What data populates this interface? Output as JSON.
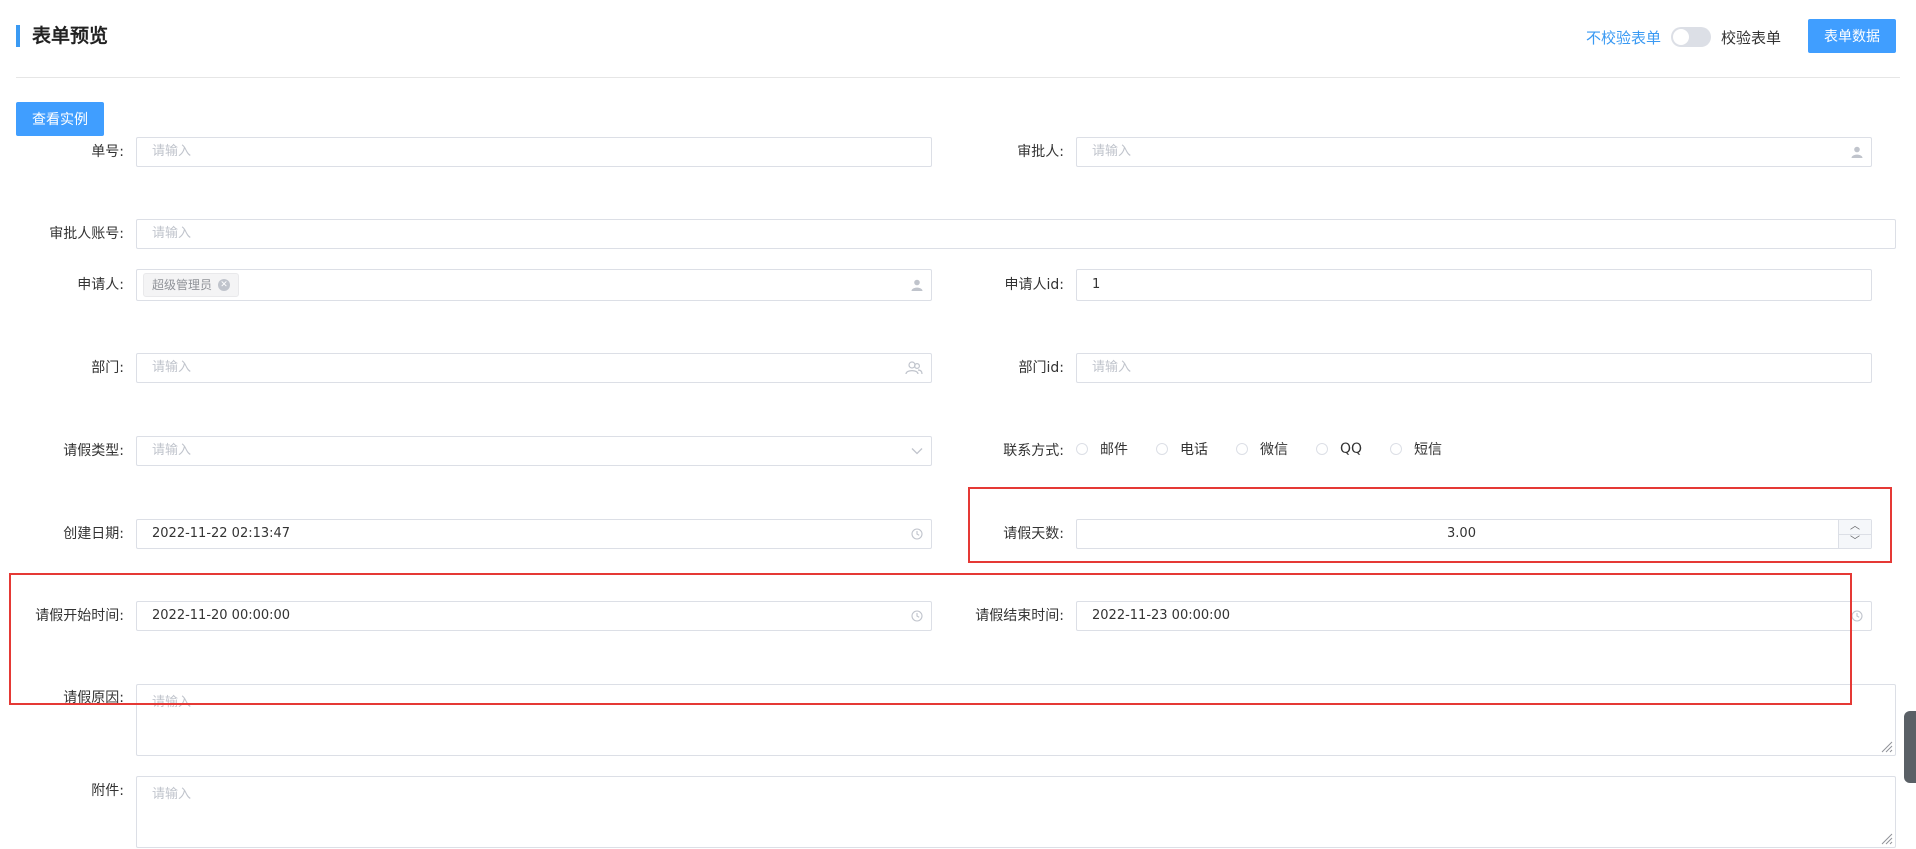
{
  "header": {
    "title": "表单预览",
    "no_validate_label": "不校验表单",
    "validate_label": "校验表单",
    "form_data_button": "表单数据"
  },
  "view_example_button": "查看实例",
  "placeholder": "请输入",
  "fields": {
    "order_no": {
      "label": "单号:"
    },
    "approver": {
      "label": "审批人:"
    },
    "approver_account": {
      "label": "审批人账号:"
    },
    "applicant": {
      "label": "申请人:",
      "tag": "超级管理员"
    },
    "applicant_id": {
      "label": "申请人id:",
      "value": "1"
    },
    "department": {
      "label": "部门:"
    },
    "department_id": {
      "label": "部门id:"
    },
    "leave_type": {
      "label": "请假类型:"
    },
    "contact": {
      "label": "联系方式:",
      "options": [
        "邮件",
        "电话",
        "微信",
        "QQ",
        "短信"
      ]
    },
    "created_date": {
      "label": "创建日期:",
      "value": "2022-11-22 02:13:47"
    },
    "leave_days": {
      "label": "请假天数:",
      "value": "3.00"
    },
    "start_time": {
      "label": "请假开始时间:",
      "value": "2022-11-20 00:00:00"
    },
    "end_time": {
      "label": "请假结束时间:",
      "value": "2022-11-23 00:00:00"
    },
    "reason": {
      "label": "请假原因:"
    },
    "attachment": {
      "label": "附件:"
    }
  },
  "colors": {
    "accent": "#409eff",
    "highlight": "#e53935"
  }
}
